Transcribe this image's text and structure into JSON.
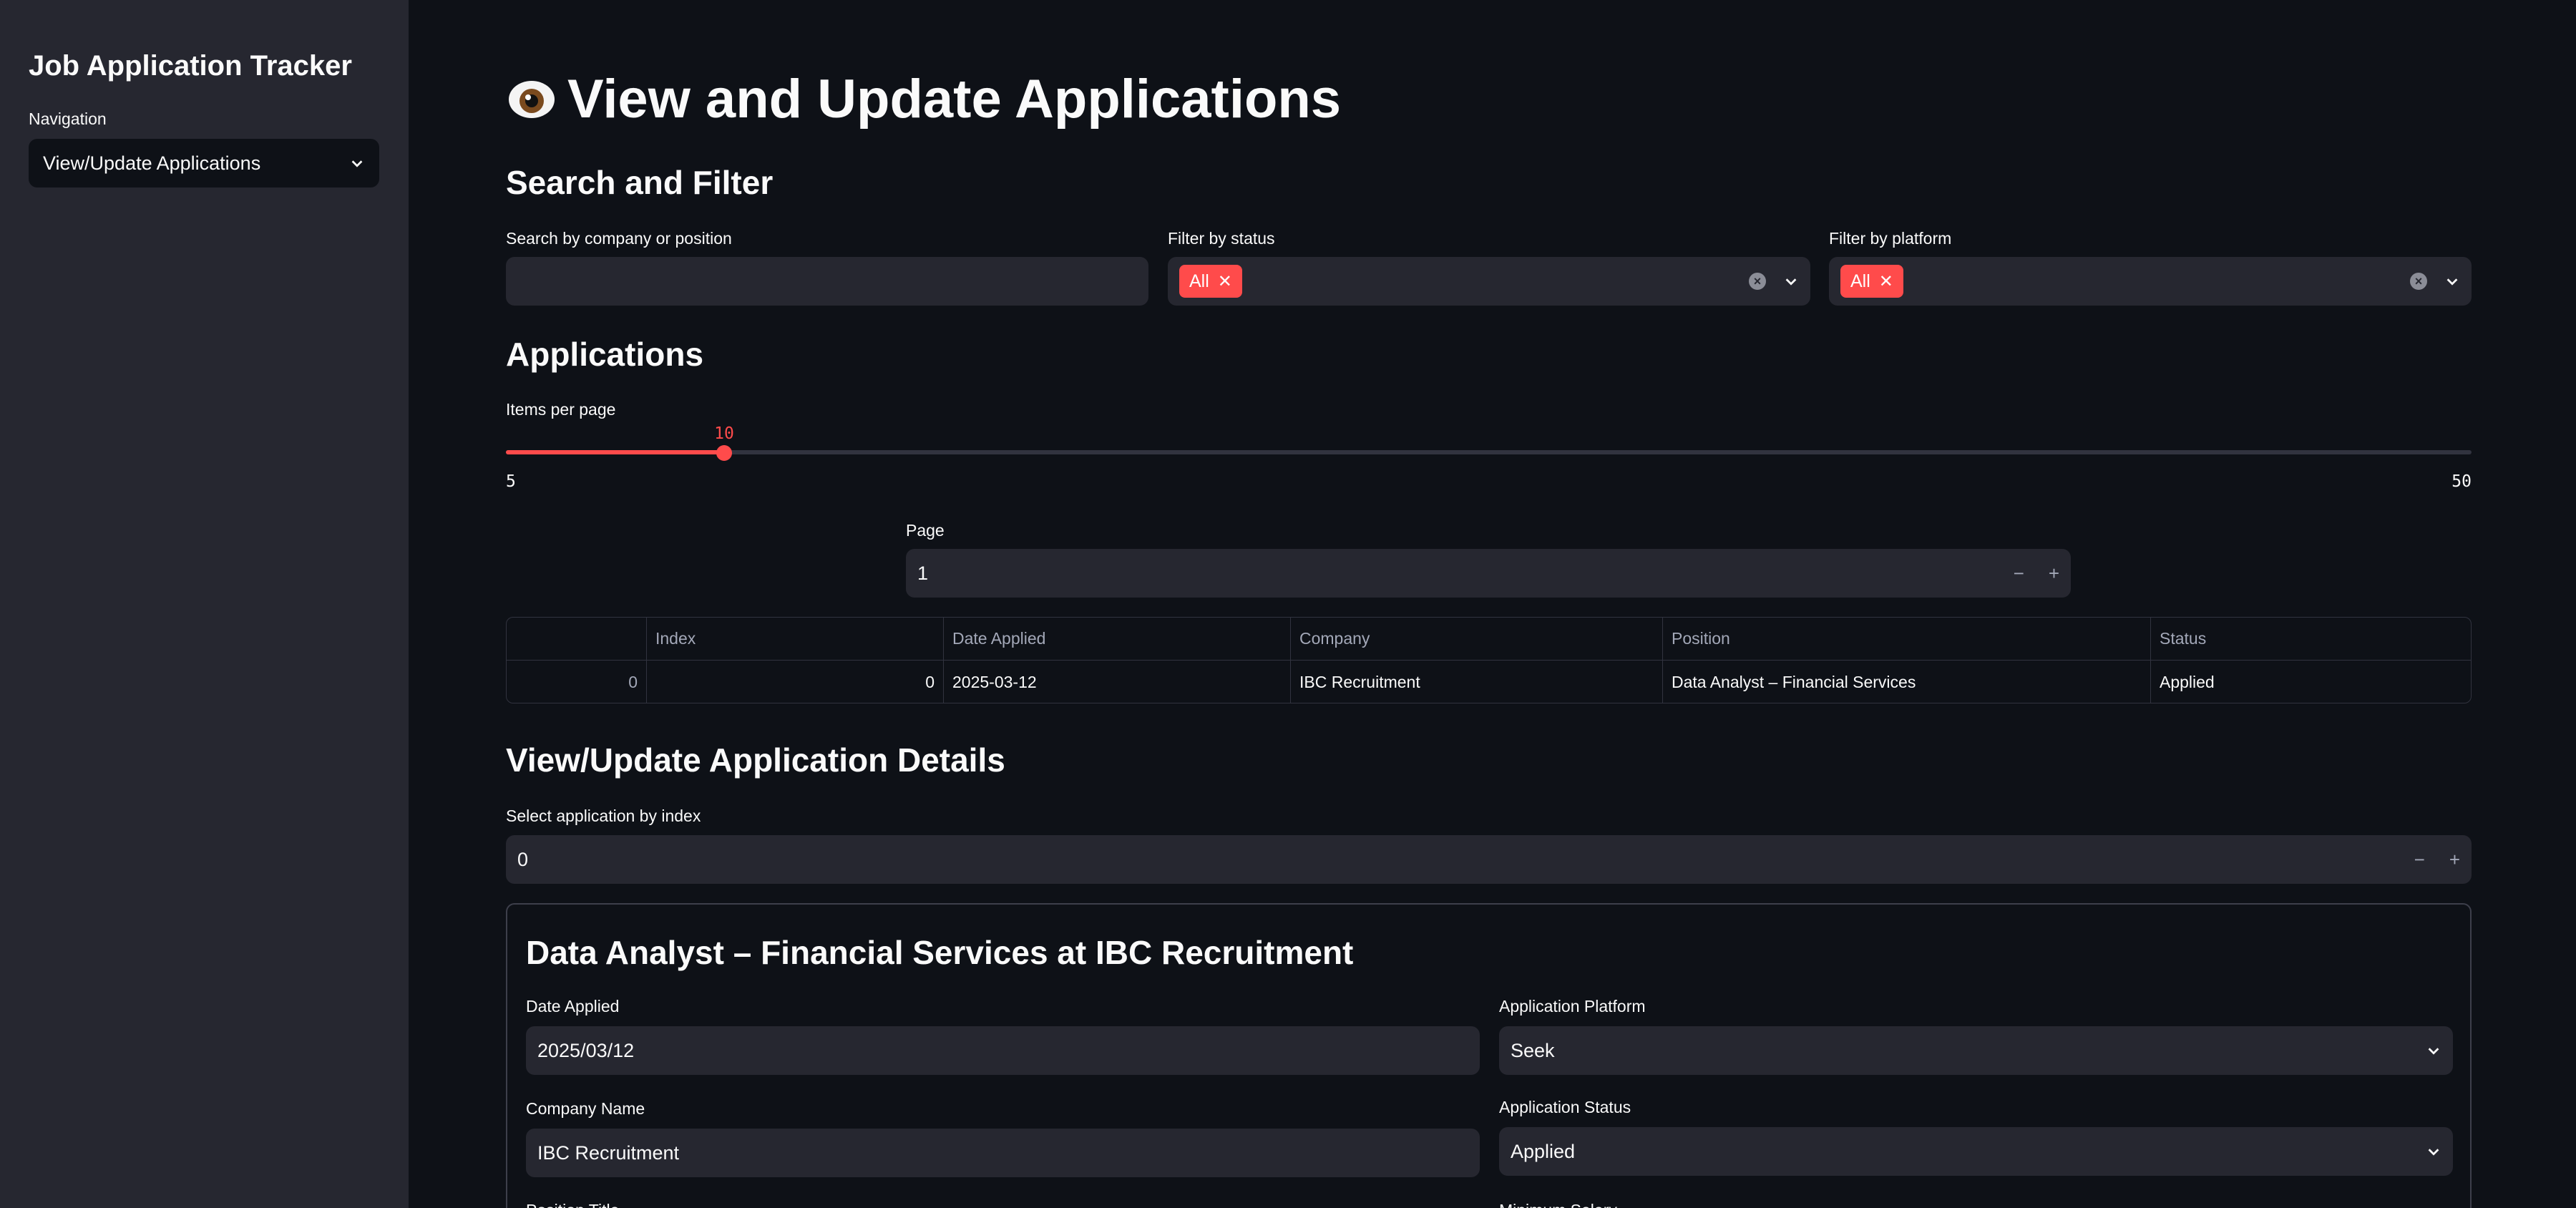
{
  "sidebar": {
    "app_title": "Job Application Tracker",
    "nav_label": "Navigation",
    "nav_value": "View/Update Applications"
  },
  "header": {
    "title": "View and Update Applications",
    "icon": "eye-icon"
  },
  "search_filter": {
    "heading": "Search and Filter",
    "search_label": "Search by company or position",
    "search_value": "",
    "status_label": "Filter by status",
    "status_tags": [
      "All"
    ],
    "platform_label": "Filter by platform",
    "platform_tags": [
      "All"
    ]
  },
  "applications": {
    "heading": "Applications",
    "items_label": "Items per page",
    "slider": {
      "value": "10",
      "min": "5",
      "max": "50",
      "fraction": 0.111
    },
    "page_label": "Page",
    "page_value": "1"
  },
  "table": {
    "columns": [
      "",
      "Index",
      "Date Applied",
      "Company",
      "Position",
      "Status"
    ],
    "rows": [
      [
        "0",
        "0",
        "2025-03-12",
        "IBC Recruitment",
        "Data Analyst – Financial Services",
        "Applied"
      ]
    ]
  },
  "details": {
    "heading": "View/Update Application Details",
    "select_label": "Select application by index",
    "select_value": "0",
    "card_title": "Data Analyst – Financial Services at IBC Recruitment",
    "date_label": "Date Applied",
    "date_value": "2025/03/12",
    "platform_label": "Application Platform",
    "platform_value": "Seek",
    "company_label": "Company Name",
    "company_value": "IBC Recruitment",
    "status_label": "Application Status",
    "status_value": "Applied",
    "position_label": "Position Title",
    "salary_label": "Minimum Salary"
  },
  "colors": {
    "accent": "#ff4b4b",
    "background": "#0e1117",
    "sidebar": "#262730"
  }
}
